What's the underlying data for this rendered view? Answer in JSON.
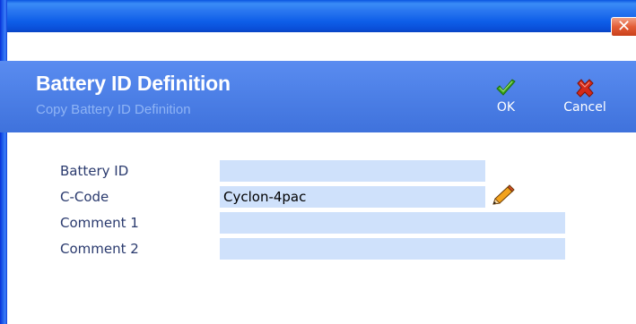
{
  "window": {
    "close_glyph": "✕"
  },
  "header": {
    "title": "Battery ID Definition",
    "subtitle": "Copy Battery ID Definition"
  },
  "toolbar": {
    "ok_label": "OK",
    "cancel_label": "Cancel"
  },
  "form": {
    "battery_id": {
      "label": "Battery ID",
      "value": ""
    },
    "c_code": {
      "label": "C-Code",
      "value": "Cyclon-4pac"
    },
    "comment1": {
      "label": "Comment 1",
      "value": ""
    },
    "comment2": {
      "label": "Comment 2",
      "value": ""
    }
  },
  "icons": {
    "ok": "checkmark-icon",
    "cancel": "red-x-icon",
    "edit": "pencil-icon"
  },
  "colors": {
    "titlebar": "#0a55e0",
    "header_band": "#4c7fe6",
    "field_bg": "#cfe1fb",
    "label_text": "#2a3a6e",
    "ok_green": "#3aa51a",
    "cancel_red": "#d42a1a"
  }
}
